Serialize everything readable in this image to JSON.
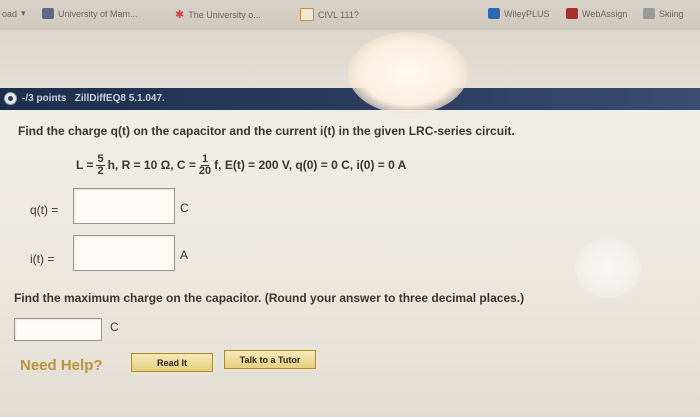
{
  "bookmarks": [
    {
      "label": "oad",
      "icon": "chevron-down-icon",
      "color": "#8a8378"
    },
    {
      "label": "University of Mam...",
      "icon": "app-icon",
      "color": "#5b6a86"
    },
    {
      "label": "The University o...",
      "icon": "star-icon",
      "color": "#d04040"
    },
    {
      "label": "CIVL 111?",
      "icon": "page-icon",
      "color": "#c28a3a"
    },
    {
      "label": "WileyPLUS",
      "icon": "wiley-icon",
      "color": "#2b6bb5"
    },
    {
      "label": "WebAssign",
      "icon": "webassign-icon",
      "color": "#a42f2f"
    },
    {
      "label": "Skiing",
      "icon": "folder-icon",
      "color": "#8a8a8a"
    }
  ],
  "question": {
    "points_label": "-/3 points",
    "problem_id": "ZillDiffEQ8 5.1.047.",
    "prompt": "Find the charge q(t) on the capacitor and the current i(t) in the given LRC-series circuit.",
    "formula": {
      "L_lhs": "L =",
      "L_num": "5",
      "L_den": "2",
      "L_unit": "h, R = 10 Ω, C =",
      "C_num": "1",
      "C_den": "20",
      "rest": "f, E(t) = 200 V, q(0) = 0 C, i(0) = 0 A"
    },
    "q_label": "q(t)  =",
    "q_value": "",
    "q_unit": "C",
    "i_label": "i(t)  =",
    "i_value": "",
    "i_unit": "A",
    "max_prompt": "Find the maximum charge on the capacitor. (Round your answer to three decimal places.)",
    "max_value": "",
    "max_unit": "C"
  },
  "help": {
    "label": "Need Help?",
    "read_it": "Read It",
    "talk_tutor": "Talk to a Tutor"
  }
}
